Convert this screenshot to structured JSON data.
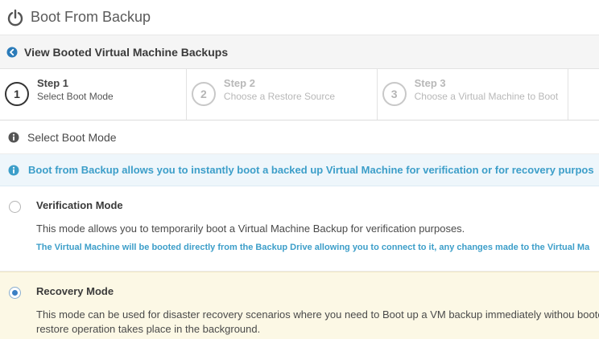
{
  "header": {
    "title": "Boot From Backup",
    "icon": "power-icon"
  },
  "back_link": {
    "label": "View Booted Virtual Machine Backups",
    "icon": "arrow-left-circle-icon"
  },
  "steps": [
    {
      "number": "1",
      "name": "Step 1",
      "desc": "Select Boot Mode",
      "active": true
    },
    {
      "number": "2",
      "name": "Step 2",
      "desc": "Choose a Restore Source",
      "active": false
    },
    {
      "number": "3",
      "name": "Step 3",
      "desc": "Choose a Virtual Machine to Boot",
      "active": false
    }
  ],
  "section": {
    "title": "Select Boot Mode",
    "icon": "info-icon"
  },
  "alert": {
    "text": "Boot from Backup allows you to instantly boot a backed up Virtual Machine for verification or for recovery purpos",
    "icon": "info-icon"
  },
  "options": [
    {
      "title": "Verification Mode",
      "desc": "This mode allows you to temporarily boot a Virtual Machine Backup for verification purposes.",
      "note": "The Virtual Machine will be booted directly from the Backup Drive allowing you to connect to it, any changes made to the Virtual Ma",
      "selected": false
    },
    {
      "title": "Recovery Mode",
      "desc": "This mode can be used for disaster recovery scenarios where you need to Boot up a VM backup immediately withou booted, a full restore operation takes place in the background.",
      "selected": true
    }
  ],
  "colors": {
    "accent": "#3c9ec9",
    "alert_bg": "#eef6fb",
    "selected_bg": "#fcf8e5",
    "radio": "#3b7fc4"
  }
}
